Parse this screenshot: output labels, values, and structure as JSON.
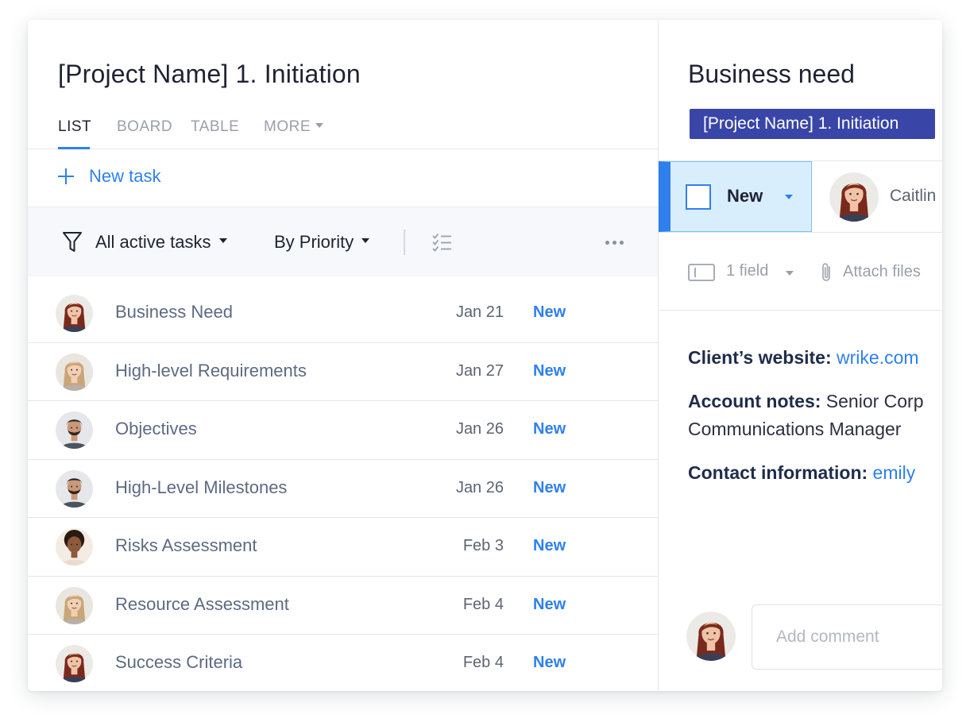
{
  "project": {
    "title": "[Project Name] 1. Initiation",
    "tabs": [
      {
        "label": "LIST",
        "active": true
      },
      {
        "label": "BOARD",
        "active": false
      },
      {
        "label": "TABLE",
        "active": false
      },
      {
        "label": "MORE",
        "active": false
      }
    ],
    "new_task_label": "New task"
  },
  "toolbar": {
    "filter_icon": "filter-icon",
    "filter_label": "All active tasks",
    "sort_label": "By Priority",
    "checklist_icon": "checklist-icon",
    "more_icon": "more-dots-icon"
  },
  "tasks": [
    {
      "name": "Business Need",
      "date": "Jan 21",
      "status": "New",
      "avatar": "woman-red-hair"
    },
    {
      "name": "High-level Requirements",
      "date": "Jan 27",
      "status": "New",
      "avatar": "woman-blonde-hair"
    },
    {
      "name": "Objectives",
      "date": "Jan 26",
      "status": "New",
      "avatar": "man-beard"
    },
    {
      "name": "High-Level Milestones",
      "date": "Jan 26",
      "status": "New",
      "avatar": "man-beard"
    },
    {
      "name": "Risks Assessment",
      "date": "Feb 3",
      "status": "New",
      "avatar": "woman-curly-hair"
    },
    {
      "name": "Resource Assessment",
      "date": "Feb 4",
      "status": "New",
      "avatar": "woman-blonde-hair"
    },
    {
      "name": "Success Criteria",
      "date": "Feb 4",
      "status": "New",
      "avatar": "woman-red-hair"
    }
  ],
  "detail": {
    "title": "Business need",
    "project_tag": "[Project Name] 1. Initiation",
    "status": "New",
    "assignee": "Caitlin",
    "field_label": "1 field",
    "attach_label": "Attach files",
    "description": {
      "website_label": "Client’s website:",
      "website_value": "wrike.com",
      "notes_label": "Account notes:",
      "notes_value": "Senior Corp",
      "notes_value_line2": "Communications Manager",
      "contact_label": "Contact information:",
      "contact_value": "emily"
    },
    "comment_placeholder": "Add comment"
  },
  "colors": {
    "accent": "#2f80ed",
    "tag_bg": "#3a45a8",
    "status_bg": "#d9eefd",
    "text_dark": "#1f2233",
    "text_muted": "#9aa0ab"
  }
}
